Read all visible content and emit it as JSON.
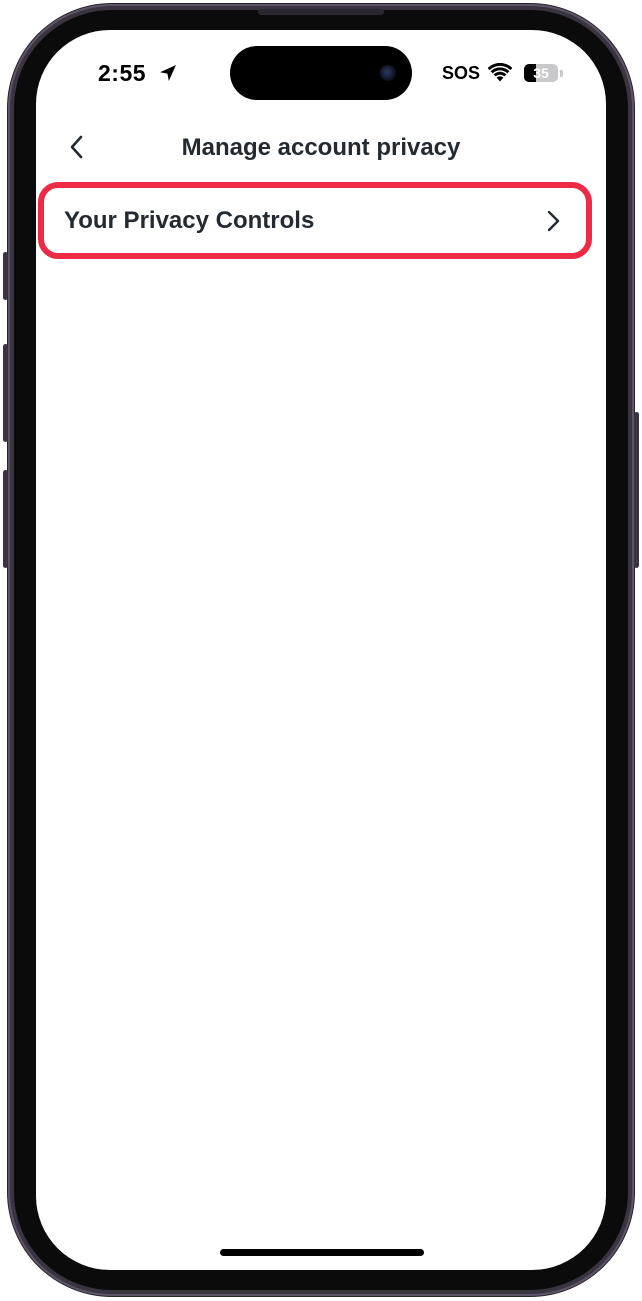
{
  "status_bar": {
    "time": "2:55",
    "carrier": "SOS",
    "battery_level": "35",
    "battery_fraction": 0.35,
    "icons": [
      "location-arrow-icon",
      "wifi-icon",
      "battery-icon"
    ]
  },
  "header": {
    "title": "Manage account privacy",
    "back_icon": "chevron-left-icon"
  },
  "list": {
    "items": [
      {
        "label": "Your Privacy Controls",
        "icon": "chevron-right-icon"
      }
    ]
  },
  "colors": {
    "highlight": "#ee2b47",
    "text": "#232a31"
  }
}
